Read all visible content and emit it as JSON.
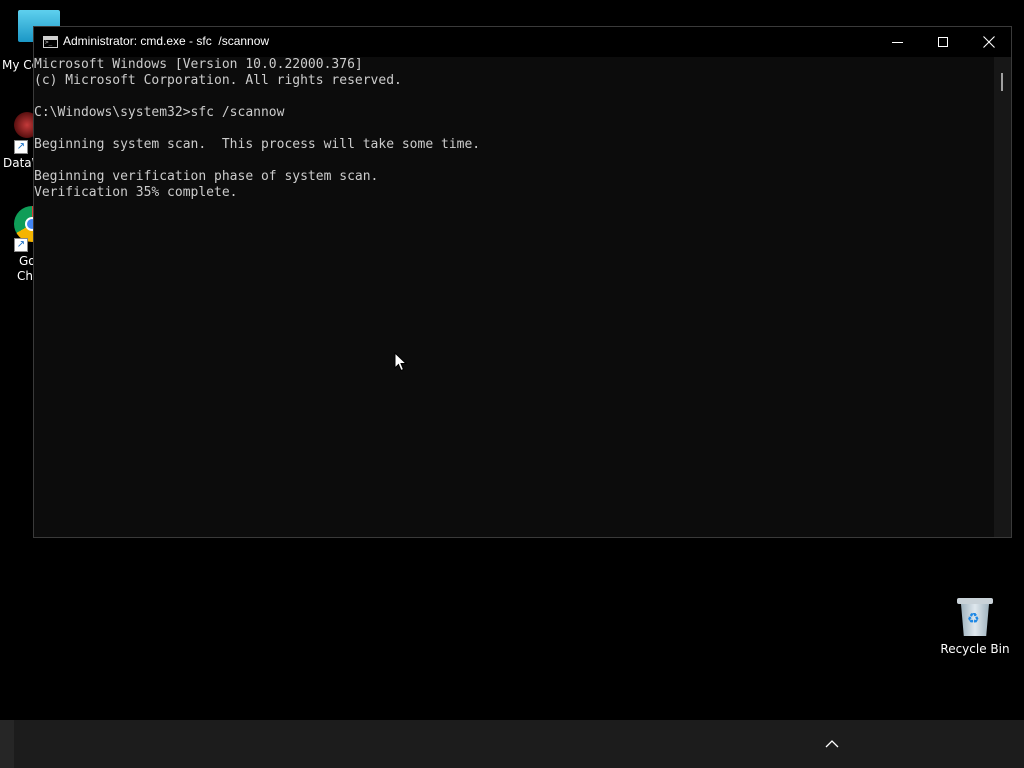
{
  "desktop": {
    "icons": [
      {
        "label": "My Co"
      },
      {
        "label": "DataW"
      },
      {
        "label_line1": "Go",
        "label_line2": "Chi"
      }
    ],
    "recycle_bin": {
      "label": "Recycle Bin"
    }
  },
  "window": {
    "title": "Administrator: cmd.exe - sfc  /scannow",
    "console_lines": [
      "Microsoft Windows [Version 10.0.22000.376]",
      "(c) Microsoft Corporation. All rights reserved.",
      "",
      "C:\\Windows\\system32>sfc /scannow",
      "",
      "Beginning system scan.  This process will take some time.",
      "",
      "Beginning verification phase of system scan.",
      "Verification 35% complete."
    ]
  },
  "colors": {
    "console_bg": "#0c0c0c",
    "console_text": "#cccccc",
    "taskbar_bg": "#1c1c1c"
  },
  "icons": {
    "window_app": "cmd-icon",
    "minimize": "minimize-icon",
    "maximize": "maximize-icon",
    "close": "close-icon",
    "tray": "chevron-up-icon",
    "recycle": "recycle-bin-icon"
  }
}
